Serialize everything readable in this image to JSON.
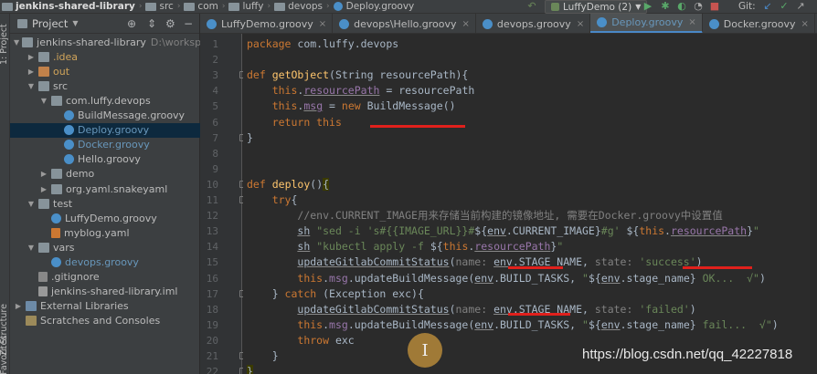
{
  "breadcrumbs": [
    "jenkins-shared-library",
    "src",
    "com",
    "luffy",
    "devops",
    "Deploy.groovy"
  ],
  "run_config": "LuffyDemo (2)",
  "git_label": "Git:",
  "left_strip": {
    "project": "1: Project",
    "structure": "Z: Structure",
    "favorites": "2: Favorites"
  },
  "project_panel": {
    "title": "Project"
  },
  "tree": [
    {
      "label": "jenkins-shared-library",
      "extra": "D:\\workspace\\ju",
      "arrow": "▼",
      "icon": "folder",
      "depth": 0
    },
    {
      "label": ".idea",
      "arrow": "▶",
      "icon": "folder",
      "depth": 1,
      "style": "orange"
    },
    {
      "label": "out",
      "arrow": "▶",
      "icon": "ofolder",
      "depth": 1,
      "style": "orange"
    },
    {
      "label": "src",
      "arrow": "▼",
      "icon": "folder",
      "depth": 1
    },
    {
      "label": "com.luffy.devops",
      "arrow": "▼",
      "icon": "pkg",
      "depth": 2
    },
    {
      "label": "BuildMessage.groovy",
      "arrow": "",
      "icon": "groovy",
      "depth": 3
    },
    {
      "label": "Deploy.groovy",
      "arrow": "",
      "icon": "groovy",
      "depth": 3,
      "style": "blue",
      "selected": true
    },
    {
      "label": "Docker.groovy",
      "arrow": "",
      "icon": "groovy",
      "depth": 3,
      "style": "blue"
    },
    {
      "label": "Hello.groovy",
      "arrow": "",
      "icon": "groovy",
      "depth": 3
    },
    {
      "label": "demo",
      "arrow": "▶",
      "icon": "pkg",
      "depth": 2
    },
    {
      "label": "org.yaml.snakeyaml",
      "arrow": "▶",
      "icon": "pkg",
      "depth": 2
    },
    {
      "label": "test",
      "arrow": "▼",
      "icon": "folder",
      "depth": 1
    },
    {
      "label": "LuffyDemo.groovy",
      "arrow": "",
      "icon": "groovy",
      "depth": 2
    },
    {
      "label": "myblog.yaml",
      "arrow": "",
      "icon": "yaml",
      "depth": 2
    },
    {
      "label": "vars",
      "arrow": "▼",
      "icon": "folder",
      "depth": 1
    },
    {
      "label": "devops.groovy",
      "arrow": "",
      "icon": "groovy",
      "depth": 2,
      "style": "blue"
    },
    {
      "label": ".gitignore",
      "arrow": "",
      "icon": "git",
      "depth": 1
    },
    {
      "label": "jenkins-shared-library.iml",
      "arrow": "",
      "icon": "iml",
      "depth": 1
    },
    {
      "label": "External Libraries",
      "arrow": "▶",
      "icon": "lib",
      "depth": 0
    },
    {
      "label": "Scratches and Consoles",
      "arrow": "",
      "icon": "sc",
      "depth": 0
    }
  ],
  "tabs": [
    {
      "label": "LuffyDemo.groovy",
      "active": false
    },
    {
      "label": "devops\\Hello.groovy",
      "active": false
    },
    {
      "label": "devops.groovy",
      "active": false
    },
    {
      "label": "Deploy.groovy",
      "active": true
    },
    {
      "label": "Docker.groovy",
      "active": false
    },
    {
      "label": "BuildMessage.groovy",
      "active": false
    }
  ],
  "code_lines": [
    {
      "n": "1",
      "html": "<span class=\"kw\">package</span> com.luffy.devops"
    },
    {
      "n": "2",
      "html": ""
    },
    {
      "n": "3",
      "html": "<span class=\"kw\">def</span> <span class=\"fn\">getObject</span>(String resourcePath){"
    },
    {
      "n": "4",
      "html": "    <span class=\"kw\">this</span>.<span class=\"fld ul\">resourcePath</span> = resourcePath"
    },
    {
      "n": "5",
      "html": "    <span class=\"kw\">this</span>.<span class=\"fld ul\">msg</span> = <span class=\"kw\">new</span> BuildMessage()"
    },
    {
      "n": "6",
      "html": "    <span class=\"kw\">return this</span>"
    },
    {
      "n": "7",
      "html": "}"
    },
    {
      "n": "8",
      "html": ""
    },
    {
      "n": "9",
      "html": ""
    },
    {
      "n": "10",
      "html": "<span class=\"kw\">def</span> <span class=\"fn\">deploy</span>()<span class=\"hl\">{</span>"
    },
    {
      "n": "11",
      "html": "    <span class=\"kw\">try</span>{"
    },
    {
      "n": "12",
      "html": "        <span class=\"cm\">//env.CURRENT_IMAGE用来存储当前构建的镜像地址, 需要在Docker.groovy中设置值</span>"
    },
    {
      "n": "13",
      "html": "        <span class=\"ul\">sh</span> <span class=\"str\">\"sed -i 's#{{IMAGE_URL}}#</span>${<span class=\"ul\">env</span>.CURRENT_IMAGE}<span class=\"str\">#g' </span>${<span class=\"kw\">this</span>.<span class=\"fld ul\">resourcePath</span>}<span class=\"str\">\"</span>"
    },
    {
      "n": "14",
      "html": "        <span class=\"ul\">sh</span> <span class=\"str\">\"kubectl apply -f </span>${<span class=\"kw\">this</span>.<span class=\"fld ul\">resourcePath</span>}<span class=\"str\">\"</span>"
    },
    {
      "n": "15",
      "html": "        <span class=\"ul\">updateGitlabCommitStatus</span>(<span class=\"cm\">name:</span> <span class=\"ul\">env</span>.STAGE_NAME, <span class=\"cm\">state:</span> <span class=\"str\">'success'</span>)"
    },
    {
      "n": "16",
      "html": "        <span class=\"kw\">this</span>.<span class=\"fld\">msg</span>.updateBuildMessage(<span class=\"ul\">env</span>.BUILD_TASKS, <span class=\"str\">\"</span>${<span class=\"ul\">env</span>.stage_name}<span class=\"str\"> OK...  √\"</span>)"
    },
    {
      "n": "17",
      "html": "    } <span class=\"kw\">catch</span> (Exception exc){"
    },
    {
      "n": "18",
      "html": "        <span class=\"ul\">updateGitlabCommitStatus</span>(<span class=\"cm\">name:</span> <span class=\"ul\">env</span>.STAGE_NAME, <span class=\"cm\">state:</span> <span class=\"str\">'failed'</span>)"
    },
    {
      "n": "19",
      "html": "        <span class=\"kw\">this</span>.<span class=\"fld\">msg</span>.updateBuildMessage(<span class=\"ul\">env</span>.BUILD_TASKS, <span class=\"str\">\"</span>${<span class=\"ul\">env</span>.stage_name}<span class=\"str\"> fail...  √\"</span>)"
    },
    {
      "n": "20",
      "html": "        <span class=\"kw\">throw</span> exc"
    },
    {
      "n": "21",
      "html": "    }"
    },
    {
      "n": "22",
      "html": "<span class=\"hl\">}</span>"
    }
  ],
  "watermark": "https://blog.csdn.net/qq_42227818",
  "cursor_glyph": "I"
}
